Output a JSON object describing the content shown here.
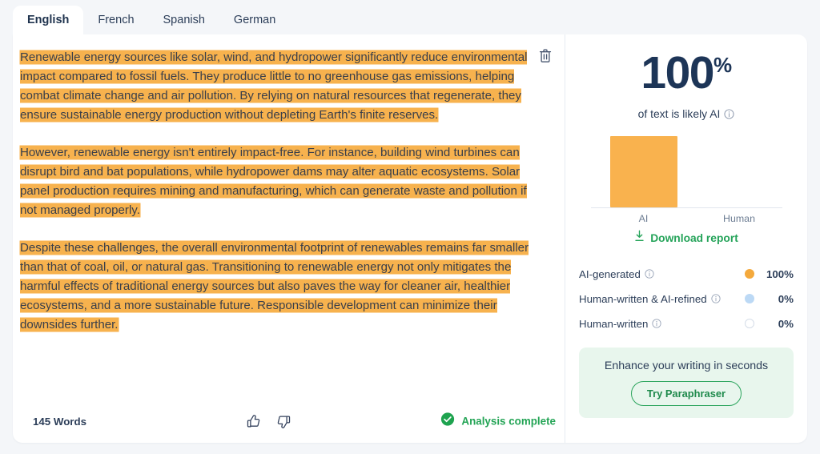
{
  "tabs": [
    {
      "label": "English",
      "active": true
    },
    {
      "label": "French",
      "active": false
    },
    {
      "label": "Spanish",
      "active": false
    },
    {
      "label": "German",
      "active": false
    }
  ],
  "editor": {
    "delete_icon": "trash-icon",
    "paragraphs": [
      "Renewable energy sources like solar, wind, and hydropower significantly reduce environmental impact compared to fossil fuels. They produce little to no greenhouse gas emissions, helping combat climate change and air pollution. By relying on natural resources that regenerate, they ensure sustainable energy production without depleting Earth's finite reserves.",
      "However, renewable energy isn't entirely impact-free. For instance, building wind turbines can disrupt bird and bat populations, while hydropower dams may alter aquatic ecosystems. Solar panel production requires mining and manufacturing, which can generate waste and pollution if not managed properly.",
      "Despite these challenges, the overall environmental footprint of renewables remains far smaller than that of coal, oil, or natural gas. Transitioning to renewable energy not only mitigates the harmful effects of traditional energy sources but also paves the way for cleaner air, healthier ecosystems, and a more sustainable future. Responsible development can minimize their downsides further."
    ]
  },
  "footer": {
    "word_count": "145 Words",
    "thumbs_up_icon": "thumbs-up-icon",
    "thumbs_down_icon": "thumbs-down-icon",
    "status_icon": "check-circle-icon",
    "status_text": "Analysis complete"
  },
  "result": {
    "score_number": "100",
    "score_percent": "%",
    "score_caption": "of text is likely AI",
    "download_label": "Download report",
    "download_icon": "download-icon",
    "info_icon": "info-icon"
  },
  "chart_data": {
    "type": "bar",
    "categories": [
      "AI",
      "Human"
    ],
    "values": [
      100,
      0
    ],
    "title": "",
    "xlabel": "",
    "ylabel": "",
    "ylim": [
      0,
      100
    ],
    "grid": false,
    "legend": "none",
    "bar_color": "#f9b24e"
  },
  "legend": {
    "rows": [
      {
        "label": "AI-generated",
        "value": "100%",
        "color": "#f4a93c",
        "style": "solid"
      },
      {
        "label": "Human-written & AI-refined",
        "value": "0%",
        "color": "#bcd9f5",
        "style": "solid"
      },
      {
        "label": "Human-written",
        "value": "0%",
        "color": "#ffffff",
        "style": "outline"
      }
    ]
  },
  "promo": {
    "text": "Enhance your writing in seconds",
    "button_label": "Try Paraphraser"
  },
  "colors": {
    "highlight": "#f7b24e",
    "accent_green": "#24a359",
    "text_navy": "#2c3e59",
    "page_bg": "#f4f6f9"
  }
}
